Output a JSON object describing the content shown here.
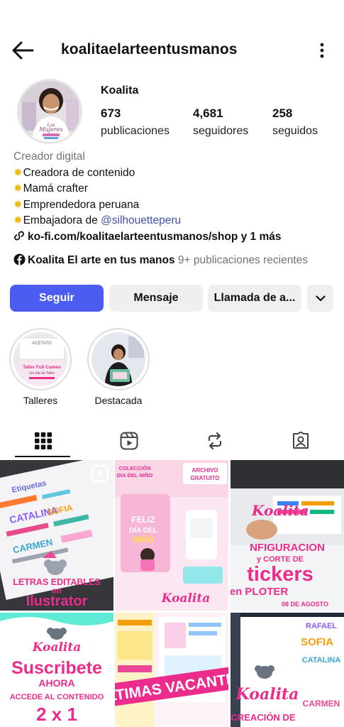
{
  "header": {
    "username": "koalitaelarteentusmanos"
  },
  "profile": {
    "name": "Koalita",
    "stats": [
      {
        "value": "673",
        "label": "publicaciones"
      },
      {
        "value": "4,681",
        "label": "seguidores"
      },
      {
        "value": "258",
        "label": "seguidos"
      }
    ],
    "category": "Creador digital",
    "bio_lines": [
      "Creadora de contenido",
      "Mamá crafter",
      "Emprendedora peruana"
    ],
    "ambassador_prefix": "Embajadora de ",
    "ambassador_mention": "@silhouetteperu",
    "link_text": "ko-fi.com/koalitaelarteentusmanos/shop y 1 más",
    "facebook_page": "Koalita El arte en tus manos",
    "facebook_recent": "9+ publicaciones recientes"
  },
  "actions": {
    "follow": "Seguir",
    "message": "Mensaje",
    "call": "Llamada de a..."
  },
  "highlights": [
    {
      "label": "Talleres",
      "cover_top": "ACETATO",
      "cover_title": "Taller Full Cameo",
      "cover_sub": "1er día de Taller"
    },
    {
      "label": "Destacada"
    }
  ],
  "grid": {
    "posts": [
      {
        "caption1": "LETRAS EDITABLES",
        "caption2": "en",
        "caption3": "Ilustrator",
        "top1": "Etiquetas",
        "names": [
          "SOFIA",
          "CATALINA",
          "CARMEN"
        ]
      },
      {
        "top1": "COLECCIÓN",
        "top2": "DIA DEL NIÑO",
        "top3": "ARCHIVO GRATUITO",
        "feliz1": "FELIZ",
        "feliz2": "DÍA DEL",
        "feliz3": "NIÑO",
        "brand": "Koalita"
      },
      {
        "brand": "Koalita",
        "l1": "NFIGURACION",
        "l2": "y CORTE DE",
        "l3": "tickers",
        "l4": "en PLOTER",
        "date": "08 DE AGOSTO"
      },
      {
        "brand": "Koalita",
        "l1": "Suscribete",
        "l2": "AHORA",
        "l3": "ACCEDE AL CONTENIDO",
        "l4": "2 x 1"
      },
      {
        "banner": "LTIMAS VACANTE"
      },
      {
        "brand": "Koalita",
        "names": [
          "RAFAEL",
          "SOFIA",
          "CATALINA",
          "CARMEN"
        ],
        "bottom": "CREACIÓN DE"
      }
    ]
  },
  "colors": {
    "primary": "#4a5df0",
    "pink": "#ec2c8c",
    "star": "#f2b80c",
    "mention": "#3d4fa6"
  }
}
